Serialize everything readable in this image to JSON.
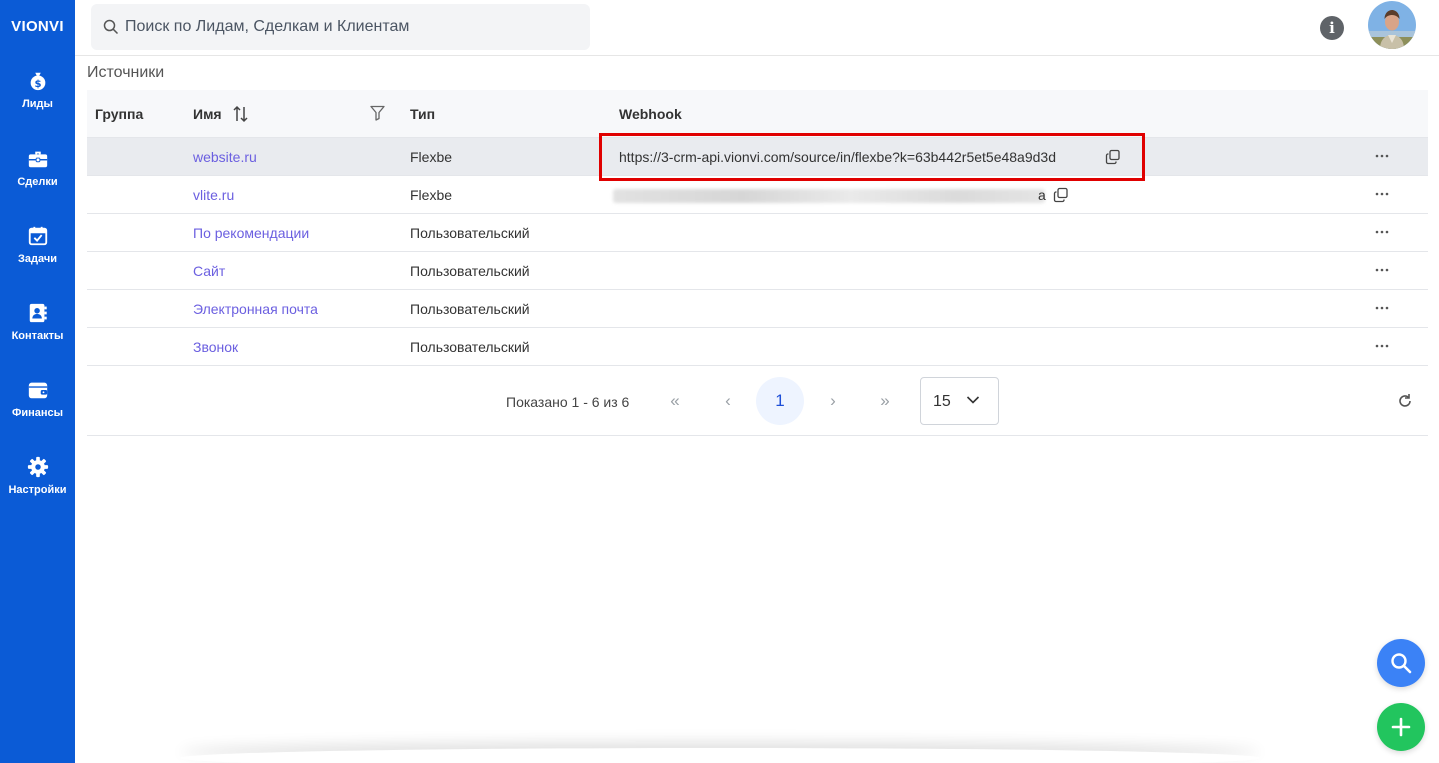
{
  "app": {
    "brand": "VIONVI"
  },
  "sidebar": {
    "items": [
      {
        "label": "Лиды",
        "icon": "money-bag-icon"
      },
      {
        "label": "Сделки",
        "icon": "briefcase-icon"
      },
      {
        "label": "Задачи",
        "icon": "calendar-check-icon"
      },
      {
        "label": "Контакты",
        "icon": "address-book-icon"
      },
      {
        "label": "Финансы",
        "icon": "wallet-icon"
      },
      {
        "label": "Настройки",
        "icon": "gear-icon"
      }
    ]
  },
  "search": {
    "placeholder": "Поиск по Лидам, Сделкам и Клиентам",
    "value": ""
  },
  "page": {
    "title": "Источники"
  },
  "table": {
    "columns": {
      "group": "Группа",
      "name": "Имя",
      "type": "Тип",
      "webhook": "Webhook"
    },
    "rows": [
      {
        "group": "",
        "name": "website.ru",
        "type": "Flexbe",
        "webhook": "https://3-crm-api.vionvi.com/source/in/flexbe?k=63b442r5et5e48a9d3d"
      },
      {
        "group": "",
        "name": "vlite.ru",
        "type": "Flexbe",
        "webhook": "a"
      },
      {
        "group": "",
        "name": "По рекомендации",
        "type": "Пользовательский",
        "webhook": ""
      },
      {
        "group": "",
        "name": "Сайт",
        "type": "Пользовательский",
        "webhook": ""
      },
      {
        "group": "",
        "name": "Электронная почта",
        "type": "Пользовательский",
        "webhook": ""
      },
      {
        "group": "",
        "name": "Звонок",
        "type": "Пользовательский",
        "webhook": ""
      }
    ]
  },
  "pagination": {
    "info": "Показано 1 - 6 из 6",
    "current_page": "1",
    "page_size": "15",
    "first": "«",
    "prev": "‹",
    "next": "›",
    "last": "»"
  },
  "colors": {
    "sidebar": "#0b5bd6",
    "link": "#6b5fe0",
    "highlight_border": "#e00000",
    "fab_search": "#3b82f6",
    "fab_add": "#22c55e"
  }
}
